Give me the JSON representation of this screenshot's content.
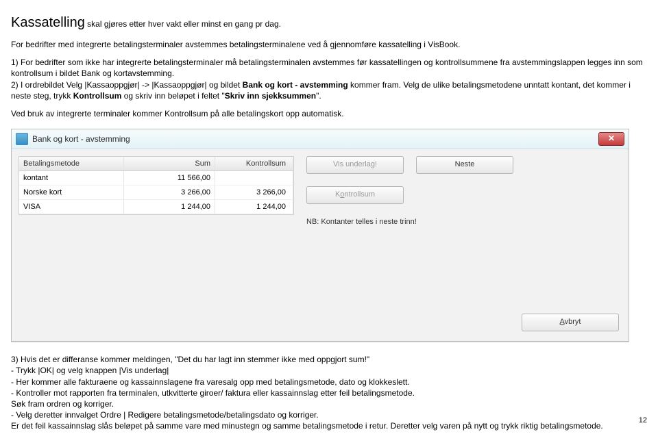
{
  "heading": "Kassatelling",
  "heading_tail": " skal gjøres etter hver vakt eller minst en gang pr dag.",
  "p1": "For bedrifter med integrerte betalingsterminaler avstemmes betalingsterminalene ved å gjennomføre kassatelling i VisBook.",
  "p2_a": "1) For bedrifter som ikke har integrerte betalingsterminaler må betalingsterminalen avstemmes før kassatellingen og kontrollsummene fra avstemmingslappen legges inn som kontrollsum i bildet Bank og kortavstemming.",
  "p2_b_pre": "2) I ordrebildet Velg |Kassaoppgjør| -> |Kassaoppgjør| og bildet ",
  "p2_b_bold": "Bank og kort - avstemming",
  "p2_b_mid": " kommer fram. Velg de ulike betalingsmetodene unntatt kontant, det kommer i neste steg, trykk ",
  "p2_b_bold2": "Kontrollsum",
  "p2_b_mid2": " og skriv inn beløpet i feltet \"",
  "p2_b_bold3": "Skriv inn sjekksummen",
  "p2_b_end": "\".",
  "p3": "Ved bruk av integrerte terminaler kommer Kontrollsum på alle betalingskort opp automatisk.",
  "dialog": {
    "title": "Bank og kort - avstemming",
    "header": {
      "method": "Betalingsmetode",
      "sum": "Sum",
      "ctrl": "Kontrollsum"
    },
    "rows": [
      {
        "method": "kontant",
        "sum": "11 566,00",
        "ctrl": ""
      },
      {
        "method": "Norske kort",
        "sum": "3 266,00",
        "ctrl": "3 266,00"
      },
      {
        "method": "VISA",
        "sum": "1 244,00",
        "ctrl": "1 244,00"
      }
    ],
    "btn_vis": "Vis underlag!",
    "btn_neste": "Neste",
    "btn_kontrollsum_pre": "K",
    "btn_kontrollsum_u": "o",
    "btn_kontrollsum_post": "ntrollsum",
    "note": "NB: Kontanter telles i neste trinn!",
    "btn_avbryt_u": "A",
    "btn_avbryt_post": "vbryt"
  },
  "p4_l1": "3) Hvis det er differanse kommer meldingen, \"Det du har lagt inn stemmer ikke med oppgjort sum!\"",
  "p4_l2": "- Trykk |OK| og velg knappen |Vis underlag|",
  "p4_l3": "- Her kommer alle fakturaene og kassainnslagene fra varesalg opp med betalingsmetode, dato og klokkeslett.",
  "p4_l4": "- Kontroller mot rapporten fra terminalen, utkvitterte giroer/ faktura eller kassainnslag etter feil betalingsmetode.",
  "p4_l5": "Søk fram ordren og korriger.",
  "p4_l6": "- Velg deretter innvalget Ordre | Redigere betalingsmetode/betalingsdato og korriger.",
  "p4_l7": "Er det feil kassainnslag slås beløpet på samme vare med minustegn og samme betalingsmetode i retur. Deretter velg varen på nytt og trykk riktig betalingsmetode.",
  "page_num": "12"
}
